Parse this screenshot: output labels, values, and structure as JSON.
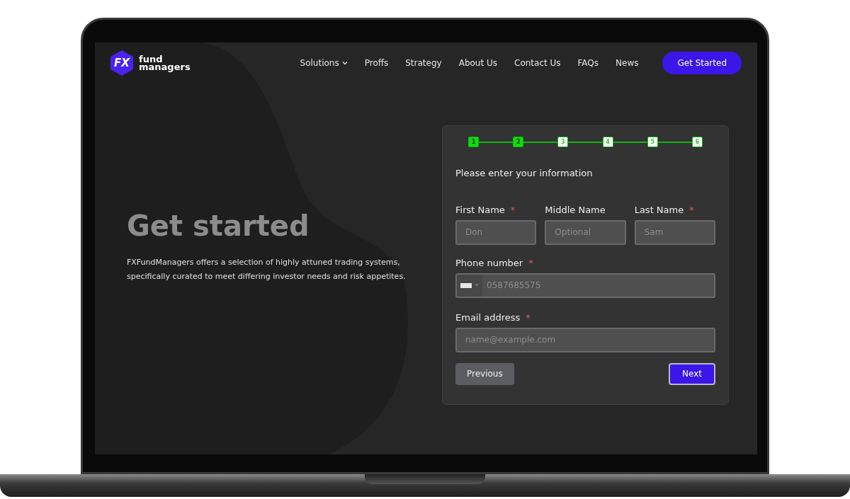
{
  "logo": {
    "mark": "FX",
    "line1": "fund",
    "line2": "managers"
  },
  "nav": [
    {
      "label": "Solutions",
      "has_menu": true
    },
    {
      "label": "Proffs",
      "has_menu": false
    },
    {
      "label": "Strategy",
      "has_menu": false
    },
    {
      "label": "About Us",
      "has_menu": false
    },
    {
      "label": "Contact Us",
      "has_menu": false
    },
    {
      "label": "FAQs",
      "has_menu": false
    },
    {
      "label": "News",
      "has_menu": false
    }
  ],
  "cta_button": "Get Started",
  "hero": {
    "title": "Get started",
    "text": "FXFundManagers offers a selection of highly attuned trading systems, specifically curated to meet differing investor needs and risk appetites."
  },
  "form": {
    "steps": [
      {
        "label": "1",
        "completed": true
      },
      {
        "label": "2",
        "completed": true
      },
      {
        "label": "3",
        "completed": false
      },
      {
        "label": "4",
        "completed": false
      },
      {
        "label": "5",
        "completed": false
      },
      {
        "label": "6",
        "completed": false
      }
    ],
    "title": "Please enter your information",
    "name_fields": [
      {
        "label": "First Name",
        "required_mark": "*",
        "placeholder": "Don"
      },
      {
        "label": "Middle Name",
        "placeholder": "Optional"
      },
      {
        "label": "Last Name",
        "required_mark": "*",
        "placeholder": "Sam"
      }
    ],
    "phone": {
      "label": "Phone number",
      "required_mark": "*",
      "placeholder": "0587685575"
    },
    "email": {
      "label": "Email address",
      "required_mark": "*",
      "placeholder": "name@example.com"
    },
    "previous_button": "Previous",
    "next_button": "Next"
  }
}
